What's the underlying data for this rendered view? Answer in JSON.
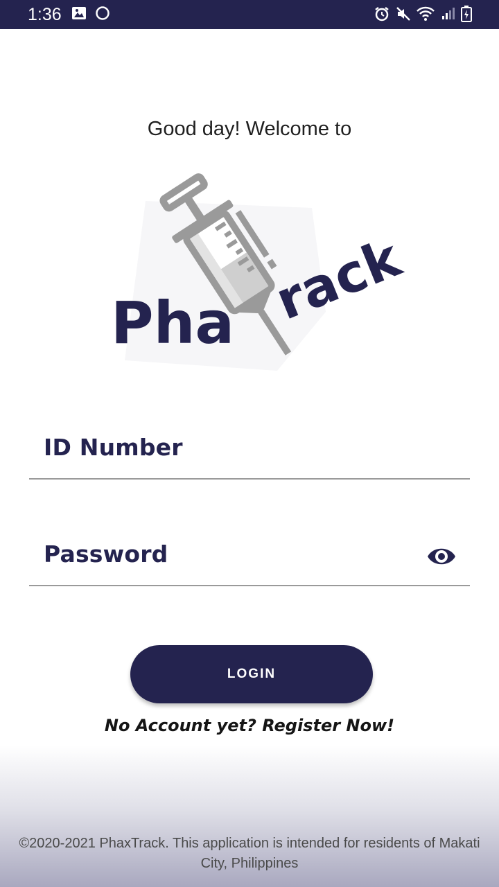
{
  "status_bar": {
    "time": "1:36",
    "left_icons": [
      "image-icon",
      "circle-icon"
    ],
    "right_icons": [
      "alarm-icon",
      "mute-icon",
      "wifi-icon",
      "signal-icon",
      "battery-icon"
    ]
  },
  "welcome_text": "Good day! Welcome to",
  "logo": {
    "wordmark_left": "Pha",
    "wordmark_right": "rack",
    "mark": "syringe-icon"
  },
  "form": {
    "id_label": "ID Number",
    "password_label": "Password",
    "password_toggle_icon": "eye-icon"
  },
  "login_label": "LOGIN",
  "register_link": "No Account yet? Register Now!",
  "footer_text": "©2020-2021 PhaxTrack. This application is intended for residents of Makati City, Philippines",
  "colors": {
    "brand": "#24234f",
    "background": "#ffffff",
    "divider": "#9a9a9a"
  }
}
